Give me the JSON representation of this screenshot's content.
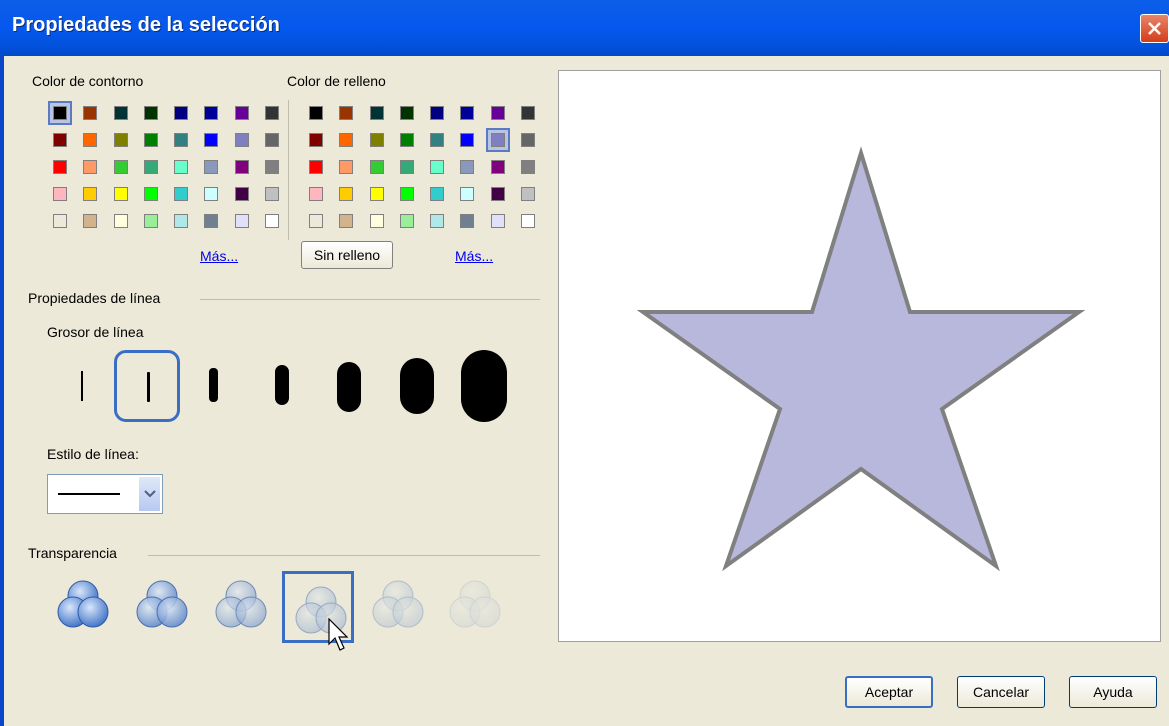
{
  "window": {
    "title": "Propiedades de la selección"
  },
  "outline_color": {
    "label": "Color de contorno",
    "more_link": "Más...",
    "swatches": [
      [
        "#000000",
        "#993300",
        "#003333",
        "#003300",
        "#000080",
        "#000099",
        "#660099",
        "#333333"
      ],
      [
        "#800000",
        "#ff6600",
        "#808000",
        "#008000",
        "#338080",
        "#0000ff",
        "#8080c0",
        "#666666"
      ],
      [
        "#ff0000",
        "#ff9966",
        "#33cc33",
        "#33aa77",
        "#66ffcc",
        "#8899bb",
        "#800080",
        "#808080"
      ],
      [
        "#ffb6c1",
        "#ffcc00",
        "#ffff00",
        "#00ff00",
        "#33cccc",
        "#ccffff",
        "#440044",
        "#c0c0c0"
      ],
      [
        "#ece9d8",
        "#d2b48c",
        "#ffffe0",
        "#99ee99",
        "#b0e8e8",
        "#708090",
        "#e0e0f8",
        "#ffffff"
      ]
    ],
    "selected": "0-0"
  },
  "fill_color": {
    "label": "Color de relleno",
    "more_link": "Más...",
    "no_fill_button": "Sin relleno",
    "swatches": [
      [
        "#000000",
        "#993300",
        "#003333",
        "#003300",
        "#000080",
        "#000099",
        "#660099",
        "#333333"
      ],
      [
        "#800000",
        "#ff6600",
        "#808000",
        "#008000",
        "#338080",
        "#0000ff",
        "#8080c0",
        "#666666"
      ],
      [
        "#ff0000",
        "#ff9966",
        "#33cc33",
        "#33aa77",
        "#66ffcc",
        "#8899bb",
        "#800080",
        "#808080"
      ],
      [
        "#ffb6c1",
        "#ffcc00",
        "#ffff00",
        "#00ff00",
        "#33cccc",
        "#ccffff",
        "#440044",
        "#c0c0c0"
      ],
      [
        "#ece9d8",
        "#d2b48c",
        "#ffffe0",
        "#99ee99",
        "#b0e8e8",
        "#708090",
        "#e0e0f8",
        "#ffffff"
      ]
    ],
    "selected": "1-6"
  },
  "line_properties": {
    "section_label": "Propiedades de línea",
    "thickness_label": "Grosor de línea",
    "thickness_options": 7,
    "thickness_selected": 1,
    "style_label": "Estilo de línea:"
  },
  "transparency": {
    "section_label": "Transparencia",
    "levels": [
      1.0,
      0.85,
      0.65,
      0.45,
      0.3,
      0.15
    ],
    "selected": 3
  },
  "preview": {
    "shape": "star",
    "fill": "#b8b8dc",
    "stroke": "#808080"
  },
  "buttons": {
    "ok": "Aceptar",
    "cancel": "Cancelar",
    "help": "Ayuda"
  }
}
